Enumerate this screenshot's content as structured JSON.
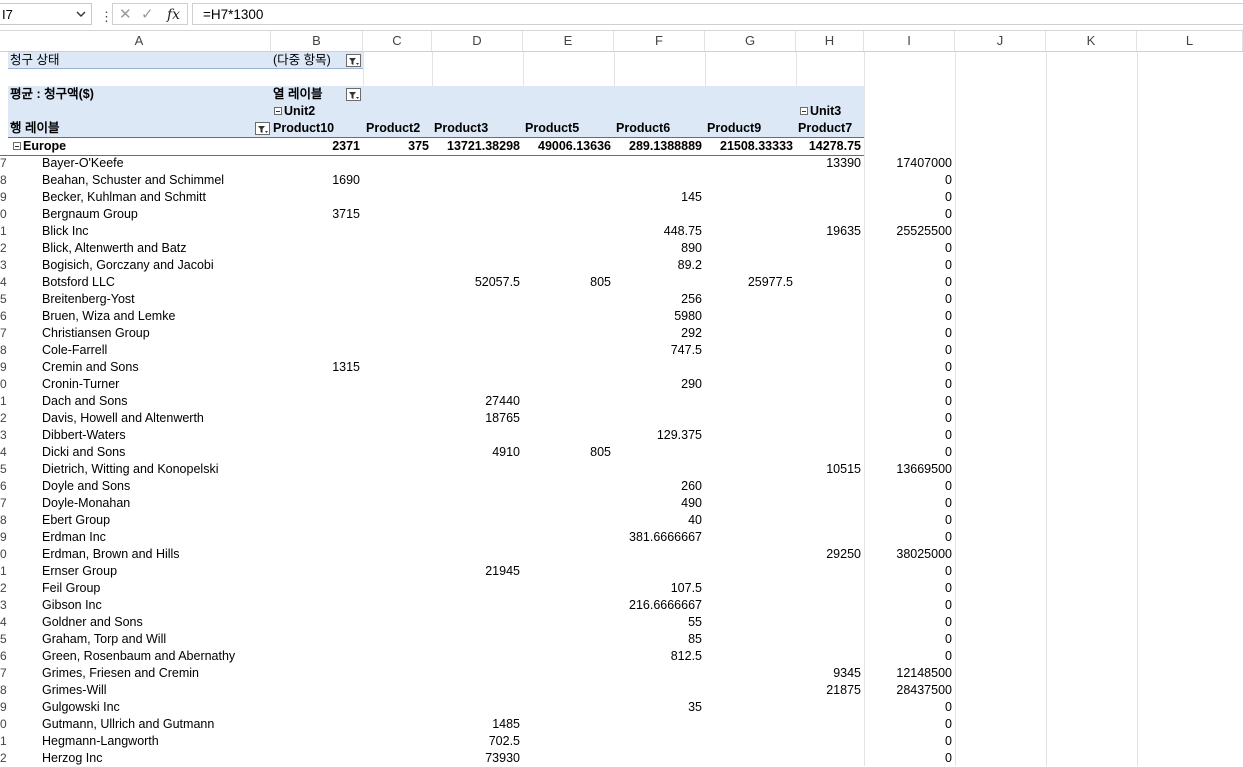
{
  "namebox": "I7",
  "formula": "=H7*1300",
  "fx_label": "fx",
  "columns": [
    "A",
    "B",
    "C",
    "D",
    "E",
    "F",
    "G",
    "H",
    "I",
    "J",
    "K",
    "L"
  ],
  "pivot": {
    "filter_label": "청구 상태",
    "filter_value": "(다중 항목)",
    "value_label": "평균 : 청구액($)",
    "col_labels": "열 레이블",
    "row_labels": "행 레이블",
    "unit2": "Unit2",
    "unit3": "Unit3",
    "products": [
      "Product10",
      "Product2",
      "Product3",
      "Product5",
      "Product6",
      "Product9",
      "Product7"
    ],
    "group": "Europe",
    "group_values": [
      "2371",
      "375",
      "13721.38298",
      "49006.13636",
      "289.1388889",
      "21508.33333",
      "14278.75"
    ]
  },
  "rows": [
    {
      "n": "7",
      "name": "Bayer-O'Keefe",
      "b": "",
      "c": "",
      "d": "",
      "e": "",
      "f": "",
      "g": "",
      "h": "13390",
      "i": "17407000"
    },
    {
      "n": "8",
      "name": "Beahan, Schuster and Schimmel",
      "b": "1690",
      "c": "",
      "d": "",
      "e": "",
      "f": "",
      "g": "",
      "h": "",
      "i": "0"
    },
    {
      "n": "9",
      "name": "Becker, Kuhlman and Schmitt",
      "b": "",
      "c": "",
      "d": "",
      "e": "",
      "f": "145",
      "g": "",
      "h": "",
      "i": "0"
    },
    {
      "n": "0",
      "name": "Bergnaum Group",
      "b": "3715",
      "c": "",
      "d": "",
      "e": "",
      "f": "",
      "g": "",
      "h": "",
      "i": "0"
    },
    {
      "n": "1",
      "name": "Blick Inc",
      "b": "",
      "c": "",
      "d": "",
      "e": "",
      "f": "448.75",
      "g": "",
      "h": "19635",
      "i": "25525500"
    },
    {
      "n": "2",
      "name": "Blick, Altenwerth and Batz",
      "b": "",
      "c": "",
      "d": "",
      "e": "",
      "f": "890",
      "g": "",
      "h": "",
      "i": "0"
    },
    {
      "n": "3",
      "name": "Bogisich, Gorczany and Jacobi",
      "b": "",
      "c": "",
      "d": "",
      "e": "",
      "f": "89.2",
      "g": "",
      "h": "",
      "i": "0"
    },
    {
      "n": "4",
      "name": "Botsford LLC",
      "b": "",
      "c": "",
      "d": "52057.5",
      "e": "805",
      "f": "",
      "g": "25977.5",
      "h": "",
      "i": "0"
    },
    {
      "n": "5",
      "name": "Breitenberg-Yost",
      "b": "",
      "c": "",
      "d": "",
      "e": "",
      "f": "256",
      "g": "",
      "h": "",
      "i": "0"
    },
    {
      "n": "6",
      "name": "Bruen, Wiza and Lemke",
      "b": "",
      "c": "",
      "d": "",
      "e": "",
      "f": "5980",
      "g": "",
      "h": "",
      "i": "0"
    },
    {
      "n": "7",
      "name": "Christiansen Group",
      "b": "",
      "c": "",
      "d": "",
      "e": "",
      "f": "292",
      "g": "",
      "h": "",
      "i": "0"
    },
    {
      "n": "8",
      "name": "Cole-Farrell",
      "b": "",
      "c": "",
      "d": "",
      "e": "",
      "f": "747.5",
      "g": "",
      "h": "",
      "i": "0"
    },
    {
      "n": "9",
      "name": "Cremin and Sons",
      "b": "1315",
      "c": "",
      "d": "",
      "e": "",
      "f": "",
      "g": "",
      "h": "",
      "i": "0"
    },
    {
      "n": "0",
      "name": "Cronin-Turner",
      "b": "",
      "c": "",
      "d": "",
      "e": "",
      "f": "290",
      "g": "",
      "h": "",
      "i": "0"
    },
    {
      "n": "1",
      "name": "Dach and Sons",
      "b": "",
      "c": "",
      "d": "27440",
      "e": "",
      "f": "",
      "g": "",
      "h": "",
      "i": "0"
    },
    {
      "n": "2",
      "name": "Davis, Howell and Altenwerth",
      "b": "",
      "c": "",
      "d": "18765",
      "e": "",
      "f": "",
      "g": "",
      "h": "",
      "i": "0"
    },
    {
      "n": "3",
      "name": "Dibbert-Waters",
      "b": "",
      "c": "",
      "d": "",
      "e": "",
      "f": "129.375",
      "g": "",
      "h": "",
      "i": "0"
    },
    {
      "n": "4",
      "name": "Dicki and Sons",
      "b": "",
      "c": "",
      "d": "4910",
      "e": "805",
      "f": "",
      "g": "",
      "h": "",
      "i": "0"
    },
    {
      "n": "5",
      "name": "Dietrich, Witting and Konopelski",
      "b": "",
      "c": "",
      "d": "",
      "e": "",
      "f": "",
      "g": "",
      "h": "10515",
      "i": "13669500"
    },
    {
      "n": "6",
      "name": "Doyle and Sons",
      "b": "",
      "c": "",
      "d": "",
      "e": "",
      "f": "260",
      "g": "",
      "h": "",
      "i": "0"
    },
    {
      "n": "7",
      "name": "Doyle-Monahan",
      "b": "",
      "c": "",
      "d": "",
      "e": "",
      "f": "490",
      "g": "",
      "h": "",
      "i": "0"
    },
    {
      "n": "8",
      "name": "Ebert Group",
      "b": "",
      "c": "",
      "d": "",
      "e": "",
      "f": "40",
      "g": "",
      "h": "",
      "i": "0"
    },
    {
      "n": "9",
      "name": "Erdman Inc",
      "b": "",
      "c": "",
      "d": "",
      "e": "",
      "f": "381.6666667",
      "g": "",
      "h": "",
      "i": "0"
    },
    {
      "n": "0",
      "name": "Erdman, Brown and Hills",
      "b": "",
      "c": "",
      "d": "",
      "e": "",
      "f": "",
      "g": "",
      "h": "29250",
      "i": "38025000"
    },
    {
      "n": "1",
      "name": "Ernser Group",
      "b": "",
      "c": "",
      "d": "21945",
      "e": "",
      "f": "",
      "g": "",
      "h": "",
      "i": "0"
    },
    {
      "n": "2",
      "name": "Feil Group",
      "b": "",
      "c": "",
      "d": "",
      "e": "",
      "f": "107.5",
      "g": "",
      "h": "",
      "i": "0"
    },
    {
      "n": "3",
      "name": "Gibson Inc",
      "b": "",
      "c": "",
      "d": "",
      "e": "",
      "f": "216.6666667",
      "g": "",
      "h": "",
      "i": "0"
    },
    {
      "n": "4",
      "name": "Goldner and Sons",
      "b": "",
      "c": "",
      "d": "",
      "e": "",
      "f": "55",
      "g": "",
      "h": "",
      "i": "0"
    },
    {
      "n": "5",
      "name": "Graham, Torp and Will",
      "b": "",
      "c": "",
      "d": "",
      "e": "",
      "f": "85",
      "g": "",
      "h": "",
      "i": "0"
    },
    {
      "n": "6",
      "name": "Green, Rosenbaum and Abernathy",
      "b": "",
      "c": "",
      "d": "",
      "e": "",
      "f": "812.5",
      "g": "",
      "h": "",
      "i": "0"
    },
    {
      "n": "7",
      "name": "Grimes, Friesen and Cremin",
      "b": "",
      "c": "",
      "d": "",
      "e": "",
      "f": "",
      "g": "",
      "h": "9345",
      "i": "12148500"
    },
    {
      "n": "8",
      "name": "Grimes-Will",
      "b": "",
      "c": "",
      "d": "",
      "e": "",
      "f": "",
      "g": "",
      "h": "21875",
      "i": "28437500"
    },
    {
      "n": "9",
      "name": "Gulgowski Inc",
      "b": "",
      "c": "",
      "d": "",
      "e": "",
      "f": "35",
      "g": "",
      "h": "",
      "i": "0"
    },
    {
      "n": "0",
      "name": "Gutmann, Ullrich and Gutmann",
      "b": "",
      "c": "",
      "d": "1485",
      "e": "",
      "f": "",
      "g": "",
      "h": "",
      "i": "0"
    },
    {
      "n": "1",
      "name": "Hegmann-Langworth",
      "b": "",
      "c": "",
      "d": "702.5",
      "e": "",
      "f": "",
      "g": "",
      "h": "",
      "i": "0"
    },
    {
      "n": "2",
      "name": "Herzog Inc",
      "b": "",
      "c": "",
      "d": "73930",
      "e": "",
      "f": "",
      "g": "",
      "h": "",
      "i": "0"
    }
  ]
}
